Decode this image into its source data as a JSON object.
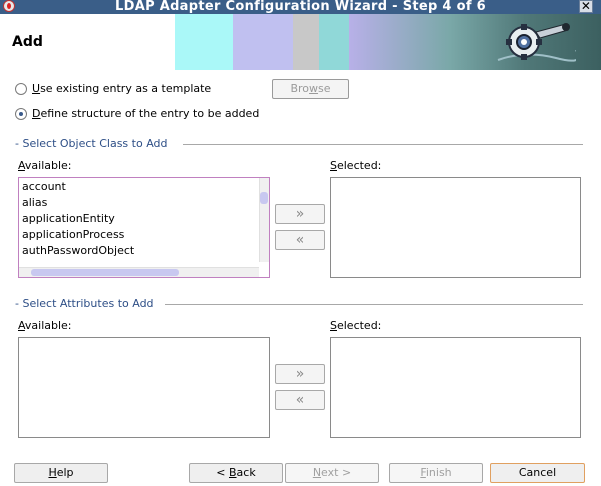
{
  "window": {
    "title": "LDAP Adapter Configuration Wizard - Step 4 of 6",
    "close_glyph": "✕"
  },
  "header": {
    "title": "Add"
  },
  "options": {
    "existing_prefix": "U",
    "existing_rest": "se existing entry as a template",
    "define_prefix": "D",
    "define_rest": "efine structure of the entry to be added",
    "browse_prefix": "Bro",
    "browse_ul": "w",
    "browse_rest": "se"
  },
  "object_class": {
    "section_title": "- Select Object Class to Add",
    "available_prefix": "A",
    "available_rest": "vailable:",
    "selected_prefix": "S",
    "selected_rest": "elected:",
    "items": [
      "account",
      "alias",
      "applicationEntity",
      "applicationProcess",
      "authPasswordObject"
    ]
  },
  "attributes": {
    "section_title": "- Select Attributes to Add",
    "available_prefix": "A",
    "available_rest": "vailable:",
    "selected_prefix": "S",
    "selected_rest": "elected:"
  },
  "arrows": {
    "add": "»",
    "remove": "«"
  },
  "buttons": {
    "help_prefix": "H",
    "help_rest": "elp",
    "back_pre": "< ",
    "back_ul": "B",
    "back_rest": "ack",
    "next_ul": "N",
    "next_rest": "ext >",
    "finish_ul": "F",
    "finish_rest": "inish",
    "cancel": "Cancel"
  },
  "colors": {
    "titlebar": "#3a5e88",
    "section_title": "#2d4e86",
    "radio_selected": "#3a5a8a"
  },
  "icons": [
    "app-icon",
    "close-icon",
    "wizard-gear-icon",
    "radio-selected-icon",
    "radio-unselected-icon",
    "add-arrow-icon",
    "remove-arrow-icon"
  ]
}
